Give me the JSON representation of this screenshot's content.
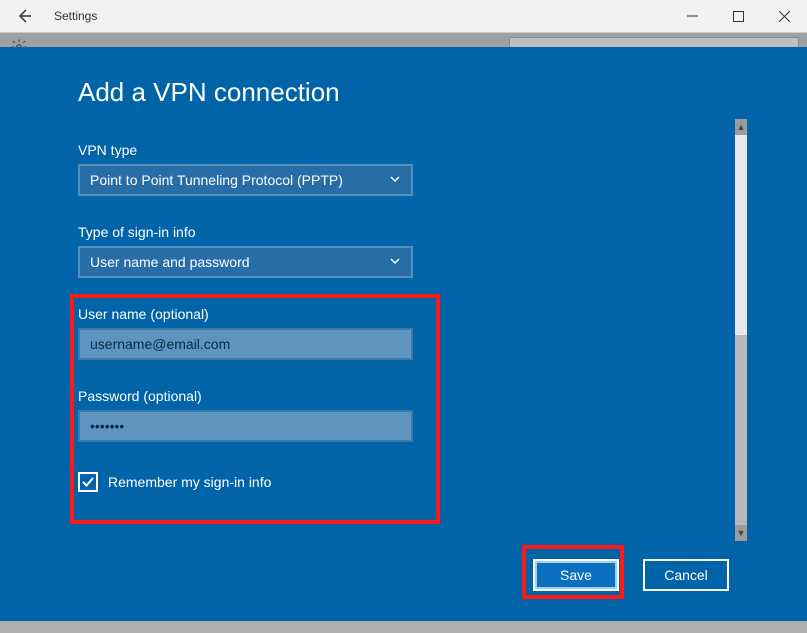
{
  "window": {
    "title": "Settings"
  },
  "overlay": {
    "heading": "Add a VPN connection"
  },
  "form": {
    "vpn_type_label": "VPN type",
    "vpn_type_value": "Point to Point Tunneling Protocol (PPTP)",
    "signin_type_label": "Type of sign-in info",
    "signin_type_value": "User name and password",
    "username_label": "User name (optional)",
    "username_value": "username@email.com",
    "password_label": "Password (optional)",
    "password_value": "•••••••",
    "remember_label": "Remember my sign-in info",
    "remember_checked": true
  },
  "buttons": {
    "save": "Save",
    "cancel": "Cancel"
  },
  "colors": {
    "overlay_bg": "#0264a8",
    "highlight": "#ff1a1a",
    "input_bg": "#5f94bf",
    "select_bg": "#276da8"
  }
}
